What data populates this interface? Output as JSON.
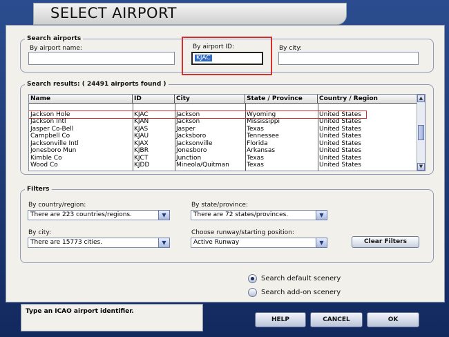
{
  "window": {
    "title": "SELECT AIRPORT"
  },
  "search": {
    "legend": "Search airports",
    "by_name_label": "By airport name:",
    "by_name_value": "",
    "by_id_label": "By airport ID:",
    "by_id_value": "KJAC",
    "by_city_label": "By city:",
    "by_city_value": ""
  },
  "results": {
    "legend": "Search results: ( 24491 airports found )",
    "columns": [
      "Name",
      "ID",
      "City",
      "State / Province",
      "Country / Region"
    ],
    "rows": [
      [
        "",
        "",
        "",
        "",
        ""
      ],
      [
        "Jackson Hole",
        "KJAC",
        "Jackson",
        "Wyoming",
        "United States"
      ],
      [
        "Jackson Intl",
        "KJAN",
        "Jackson",
        "Mississippi",
        "United States"
      ],
      [
        "Jasper Co-Bell",
        "KJAS",
        "Jasper",
        "Texas",
        "United States"
      ],
      [
        "Campbell Co",
        "KJAU",
        "Jacksboro",
        "Tennessee",
        "United States"
      ],
      [
        "Jacksonville Intl",
        "KJAX",
        "Jacksonville",
        "Florida",
        "United States"
      ],
      [
        "Jonesboro Mun",
        "KJBR",
        "Jonesboro",
        "Arkansas",
        "United States"
      ],
      [
        "Kimble Co",
        "KJCT",
        "Junction",
        "Texas",
        "United States"
      ],
      [
        "Wood Co",
        "KJDD",
        "Mineola/Quitman",
        "Texas",
        "United States"
      ]
    ],
    "selected_row": 1
  },
  "filters": {
    "legend": "Filters",
    "country_label": "By country/region:",
    "country_value": "There are 223 countries/regions.",
    "state_label": "By state/province:",
    "state_value": "There are 72 states/provinces.",
    "city_label": "By city:",
    "city_value": "There are 15773 cities.",
    "runway_label": "Choose runway/starting position:",
    "runway_value": "Active Runway",
    "clear_button": "Clear Filters"
  },
  "scenery": {
    "default_label": "Search default scenery",
    "addon_label": "Search add-on scenery",
    "selected": "default"
  },
  "status": {
    "text": "Type an ICAO airport identifier."
  },
  "buttons": {
    "help": "HELP",
    "cancel": "CANCEL",
    "ok": "OK"
  }
}
